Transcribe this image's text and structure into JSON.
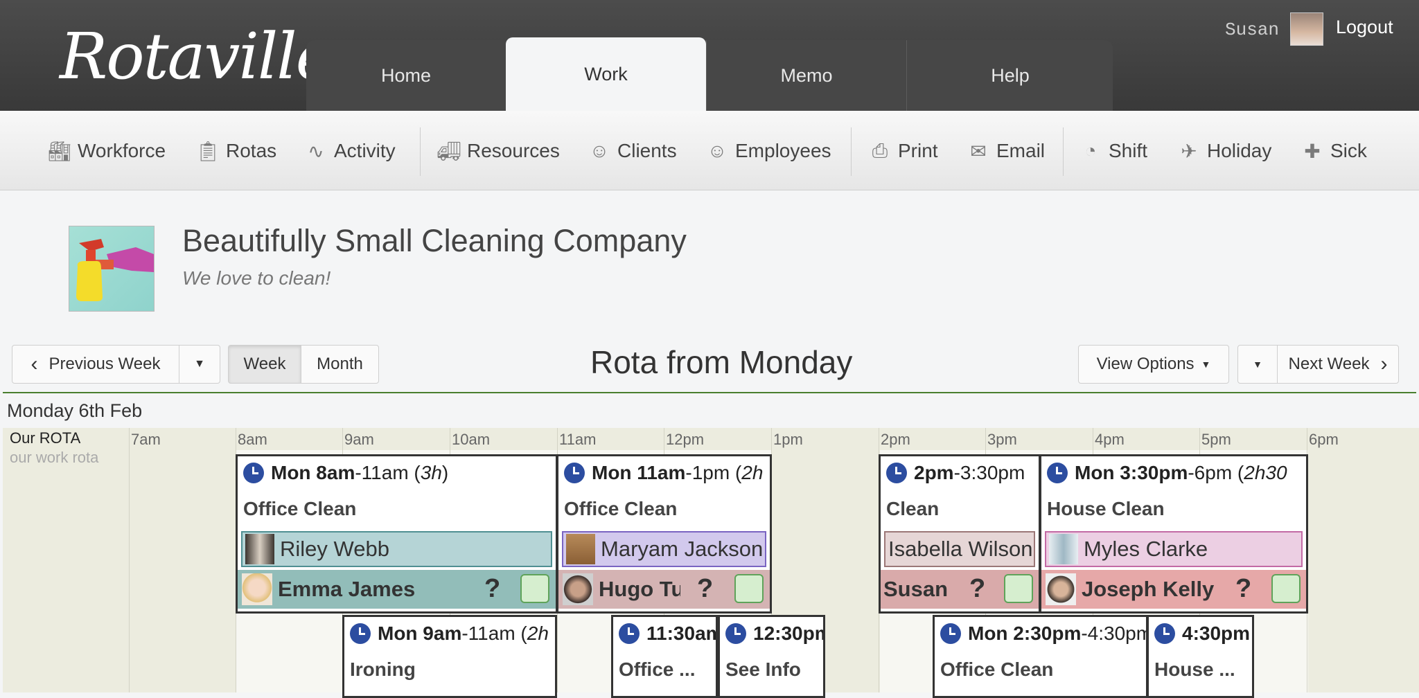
{
  "app": {
    "logo": "Rotaville"
  },
  "nav_tabs": {
    "home": "Home",
    "work": "Work",
    "memo": "Memo",
    "help": "Help"
  },
  "user": {
    "name": "Susan",
    "logout": "Logout"
  },
  "toolbar": [
    {
      "label": "Workforce",
      "icon": "factory-icon"
    },
    {
      "label": "Rotas",
      "icon": "clipboard-icon"
    },
    {
      "label": "Activity",
      "icon": "pulse-icon"
    },
    {
      "label": "Resources",
      "icon": "truck-icon"
    },
    {
      "label": "Clients",
      "icon": "client-icon"
    },
    {
      "label": "Employees",
      "icon": "person-icon"
    },
    {
      "label": "Print",
      "icon": "printer-icon"
    },
    {
      "label": "Email",
      "icon": "envelope-icon"
    },
    {
      "label": "Shift",
      "icon": "clock-icon"
    },
    {
      "label": "Holiday",
      "icon": "plane-icon"
    },
    {
      "label": "Sick",
      "icon": "medkit-icon"
    }
  ],
  "company": {
    "name": "Beautifully Small Cleaning Company",
    "tagline": "We love to clean!"
  },
  "controls": {
    "prev_week": "Previous Week",
    "week": "Week",
    "month": "Month",
    "view_options": "View Options",
    "next_week": "Next Week"
  },
  "rota": {
    "title": "Rota from Monday",
    "day": "Monday 6th Feb",
    "name": "Our ROTA",
    "subtitle": "our work rota",
    "hours": [
      "7am",
      "8am",
      "9am",
      "10am",
      "11am",
      "12pm",
      "1pm",
      "2pm",
      "3pm",
      "4pm",
      "5pm",
      "6pm"
    ]
  },
  "shifts": [
    {
      "day": "Mon 8am",
      "rest": "-11am (",
      "dur": "3h",
      "close": ")",
      "title": "Office Clean",
      "resource": "Riley Webb",
      "employee": "Emma James",
      "res_bg": "#b5d4d6",
      "res_border": "#4f8f92",
      "emp_bg": "#92bdb9"
    },
    {
      "day": "Mon 11am",
      "rest": "-1pm (",
      "dur": "2h",
      "close": "",
      "title": "Office Clean",
      "resource": "Maryam Jackson",
      "employee": "Hugo Turner",
      "res_bg": "#d2c9ed",
      "res_border": "#7a64c2",
      "emp_bg": "#d4b3b3"
    },
    {
      "day": "2pm",
      "rest": "-3:30pm",
      "dur": "",
      "close": "",
      "title": "Clean",
      "resource": "Isabella Wilson",
      "employee": "Susan",
      "res_bg": "#e6d6d6",
      "res_border": "#9b7777",
      "emp_bg": "#d9aaaa"
    },
    {
      "day": "Mon 3:30pm",
      "rest": "-6pm (",
      "dur": "2h30",
      "close": "",
      "title": "House Clean",
      "resource": "Myles Clarke",
      "employee": "Joseph Kelly",
      "res_bg": "#eccfe3",
      "res_border": "#c36aa5",
      "emp_bg": "#e6a8a8"
    },
    {
      "day": "Mon 9am",
      "rest": "-11am (",
      "dur": "2h",
      "close": "",
      "title": "Ironing"
    },
    {
      "day": "11:30am",
      "rest": "",
      "dur": "",
      "close": "",
      "title": "Office ..."
    },
    {
      "day": "12:30pm",
      "rest": "",
      "dur": "",
      "close": "",
      "title": "See Info"
    },
    {
      "day": "Mon 2:30pm",
      "rest": "-4:30pm",
      "dur": "",
      "close": "",
      "title": "Office Clean"
    },
    {
      "day": "4:30pm",
      "rest": "",
      "dur": "",
      "close": "",
      "title": "House ..."
    }
  ],
  "marks": {
    "unknown": "?"
  }
}
